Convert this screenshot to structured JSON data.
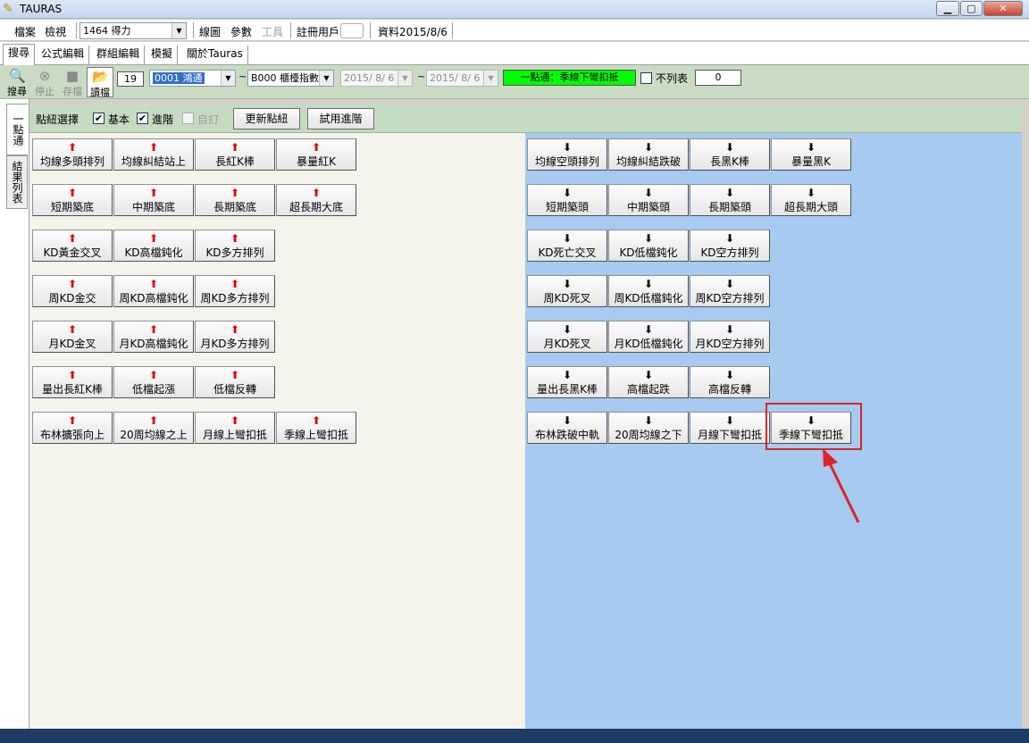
{
  "window": {
    "title": "TAURAS",
    "min": "▁",
    "max": "▢",
    "close": "✕"
  },
  "menu": {
    "file": "檔案",
    "view": "檢視",
    "chart": "線圖",
    "params": "參數",
    "tools": "工具",
    "reg_user": "註冊用戶",
    "data": "資料2015/8/6"
  },
  "stock_combo": "1464 得力",
  "tabs": [
    "搜尋",
    "公式編輯",
    "群組編輯",
    "模擬",
    "關於Tauras"
  ],
  "toolbar": {
    "search": "搜尋",
    "stop": "停止",
    "save": "存檔",
    "load": "讀檔",
    "count": "19",
    "stock": "0001 鴻通",
    "tilde1": "~",
    "index": "B000 櫃檯指數",
    "tilde2": "~",
    "date_from": "2015/ 8/ 6",
    "date_to": "2015/ 8/ 6",
    "status": "一點通：季線下彎扣抵",
    "nolist": "不列表",
    "nolist_count": "0"
  },
  "side_tabs": [
    "一點通",
    "結果列表"
  ],
  "controls": {
    "label": "點紐選擇",
    "basic": "基本",
    "advanced": "進階",
    "custom": "自訂",
    "update": "更新點紐",
    "try": "試用進階"
  },
  "bull_rows": [
    [
      "均線多頭排列",
      "均線糾結站上",
      "長紅K棒",
      "暴量紅K"
    ],
    [
      "短期築底",
      "中期築底",
      "長期築底",
      "超長期大底"
    ],
    [
      "KD黃金交叉",
      "KD高檔鈍化",
      "KD多方排列"
    ],
    [
      "周KD金交",
      "周KD高檔鈍化",
      "周KD多方排列"
    ],
    [
      "月KD金叉",
      "月KD高檔鈍化",
      "月KD多方排列"
    ],
    [
      "量出長紅K棒",
      "低檔起漲",
      "低檔反轉"
    ],
    [
      "布林擴張向上",
      "20周均線之上",
      "月線上彎扣抵",
      "季線上彎扣抵"
    ]
  ],
  "bear_rows": [
    [
      "均線空頭排列",
      "均線糾結跌破",
      "長黑K棒",
      "暴量黑K"
    ],
    [
      "短期築頭",
      "中期築頭",
      "長期築頭",
      "超長期大頭"
    ],
    [
      "KD死亡交叉",
      "KD低檔鈍化",
      "KD空方排列"
    ],
    [
      "周KD死叉",
      "周KD低檔鈍化",
      "周KD空方排列"
    ],
    [
      "月KD死叉",
      "月KD低檔鈍化",
      "月KD空方排列"
    ],
    [
      "量出長黑K棒",
      "高檔起跌",
      "高檔反轉"
    ],
    [
      "布林跌破中軌",
      "20周均線之下",
      "月線下彎扣抵",
      "季線下彎扣抵"
    ]
  ],
  "arrows": {
    "up": "⬆",
    "down": "⬇"
  },
  "colors": {
    "highlight": "#d8262a",
    "bull_arrow": "#e00000",
    "bear_panel": "#a6caf0",
    "status_green": "#00ff00"
  }
}
